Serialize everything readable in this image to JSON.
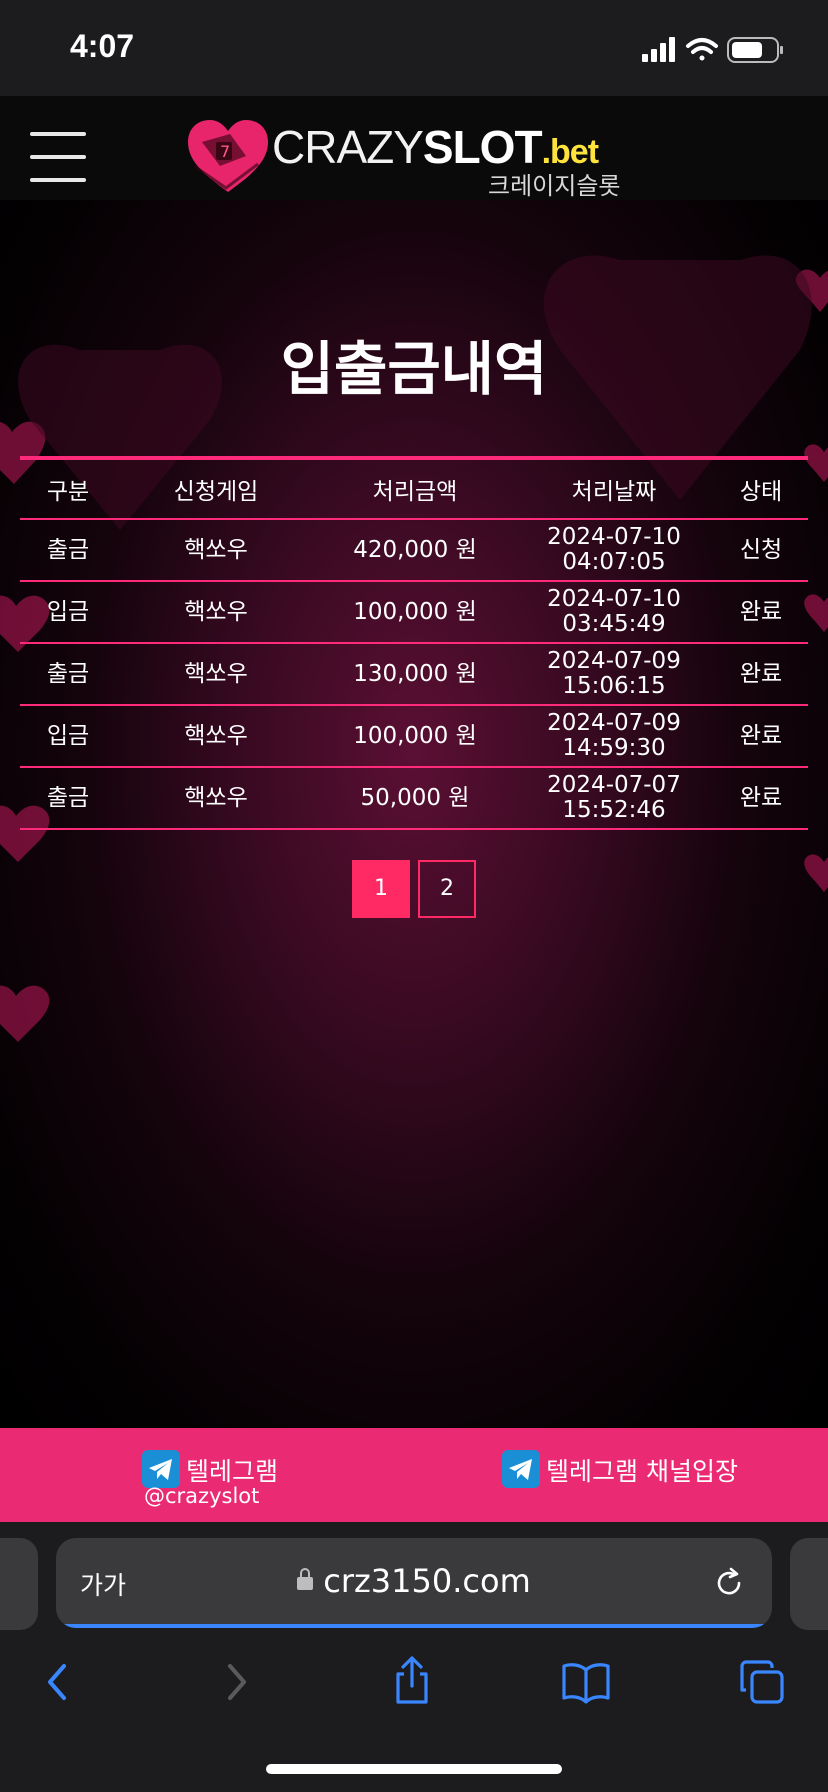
{
  "status_bar": {
    "time": "4:07"
  },
  "header": {
    "logo_part1": "CRAZY",
    "logo_part2": "SLOT",
    "logo_part3": ".bet",
    "logo_subtitle": "크레이지슬롯"
  },
  "page": {
    "title": "입출금내역"
  },
  "table": {
    "headers": [
      "구분",
      "신청게임",
      "처리금액",
      "처리날짜",
      "상태"
    ],
    "rows": [
      {
        "type": "출금",
        "game": "핵쏘우",
        "amount": "420,000 원",
        "date": "2024-07-10",
        "time": "04:07:05",
        "status": "신청"
      },
      {
        "type": "입금",
        "game": "핵쏘우",
        "amount": "100,000 원",
        "date": "2024-07-10",
        "time": "03:45:49",
        "status": "완료"
      },
      {
        "type": "출금",
        "game": "핵쏘우",
        "amount": "130,000 원",
        "date": "2024-07-09",
        "time": "15:06:15",
        "status": "완료"
      },
      {
        "type": "입금",
        "game": "핵쏘우",
        "amount": "100,000 원",
        "date": "2024-07-09",
        "time": "14:59:30",
        "status": "완료"
      },
      {
        "type": "출금",
        "game": "핵쏘우",
        "amount": "50,000 원",
        "date": "2024-07-07",
        "time": "15:52:46",
        "status": "완료"
      }
    ]
  },
  "pagination": {
    "pages": [
      "1",
      "2"
    ],
    "current": "1"
  },
  "telegram": {
    "item1_label": "텔레그램",
    "item1_sub": "@crazyslot",
    "item2_label": "텔레그램 채널입장"
  },
  "browser": {
    "aa_label": "가가",
    "url": "crz3150.com",
    "load_progress": 1.0
  },
  "colors": {
    "accent": "#ff2a7a",
    "telegram_bar": "#ea2a72",
    "active_page": "#ff2a64",
    "ios_blue": "#3a86ff"
  }
}
